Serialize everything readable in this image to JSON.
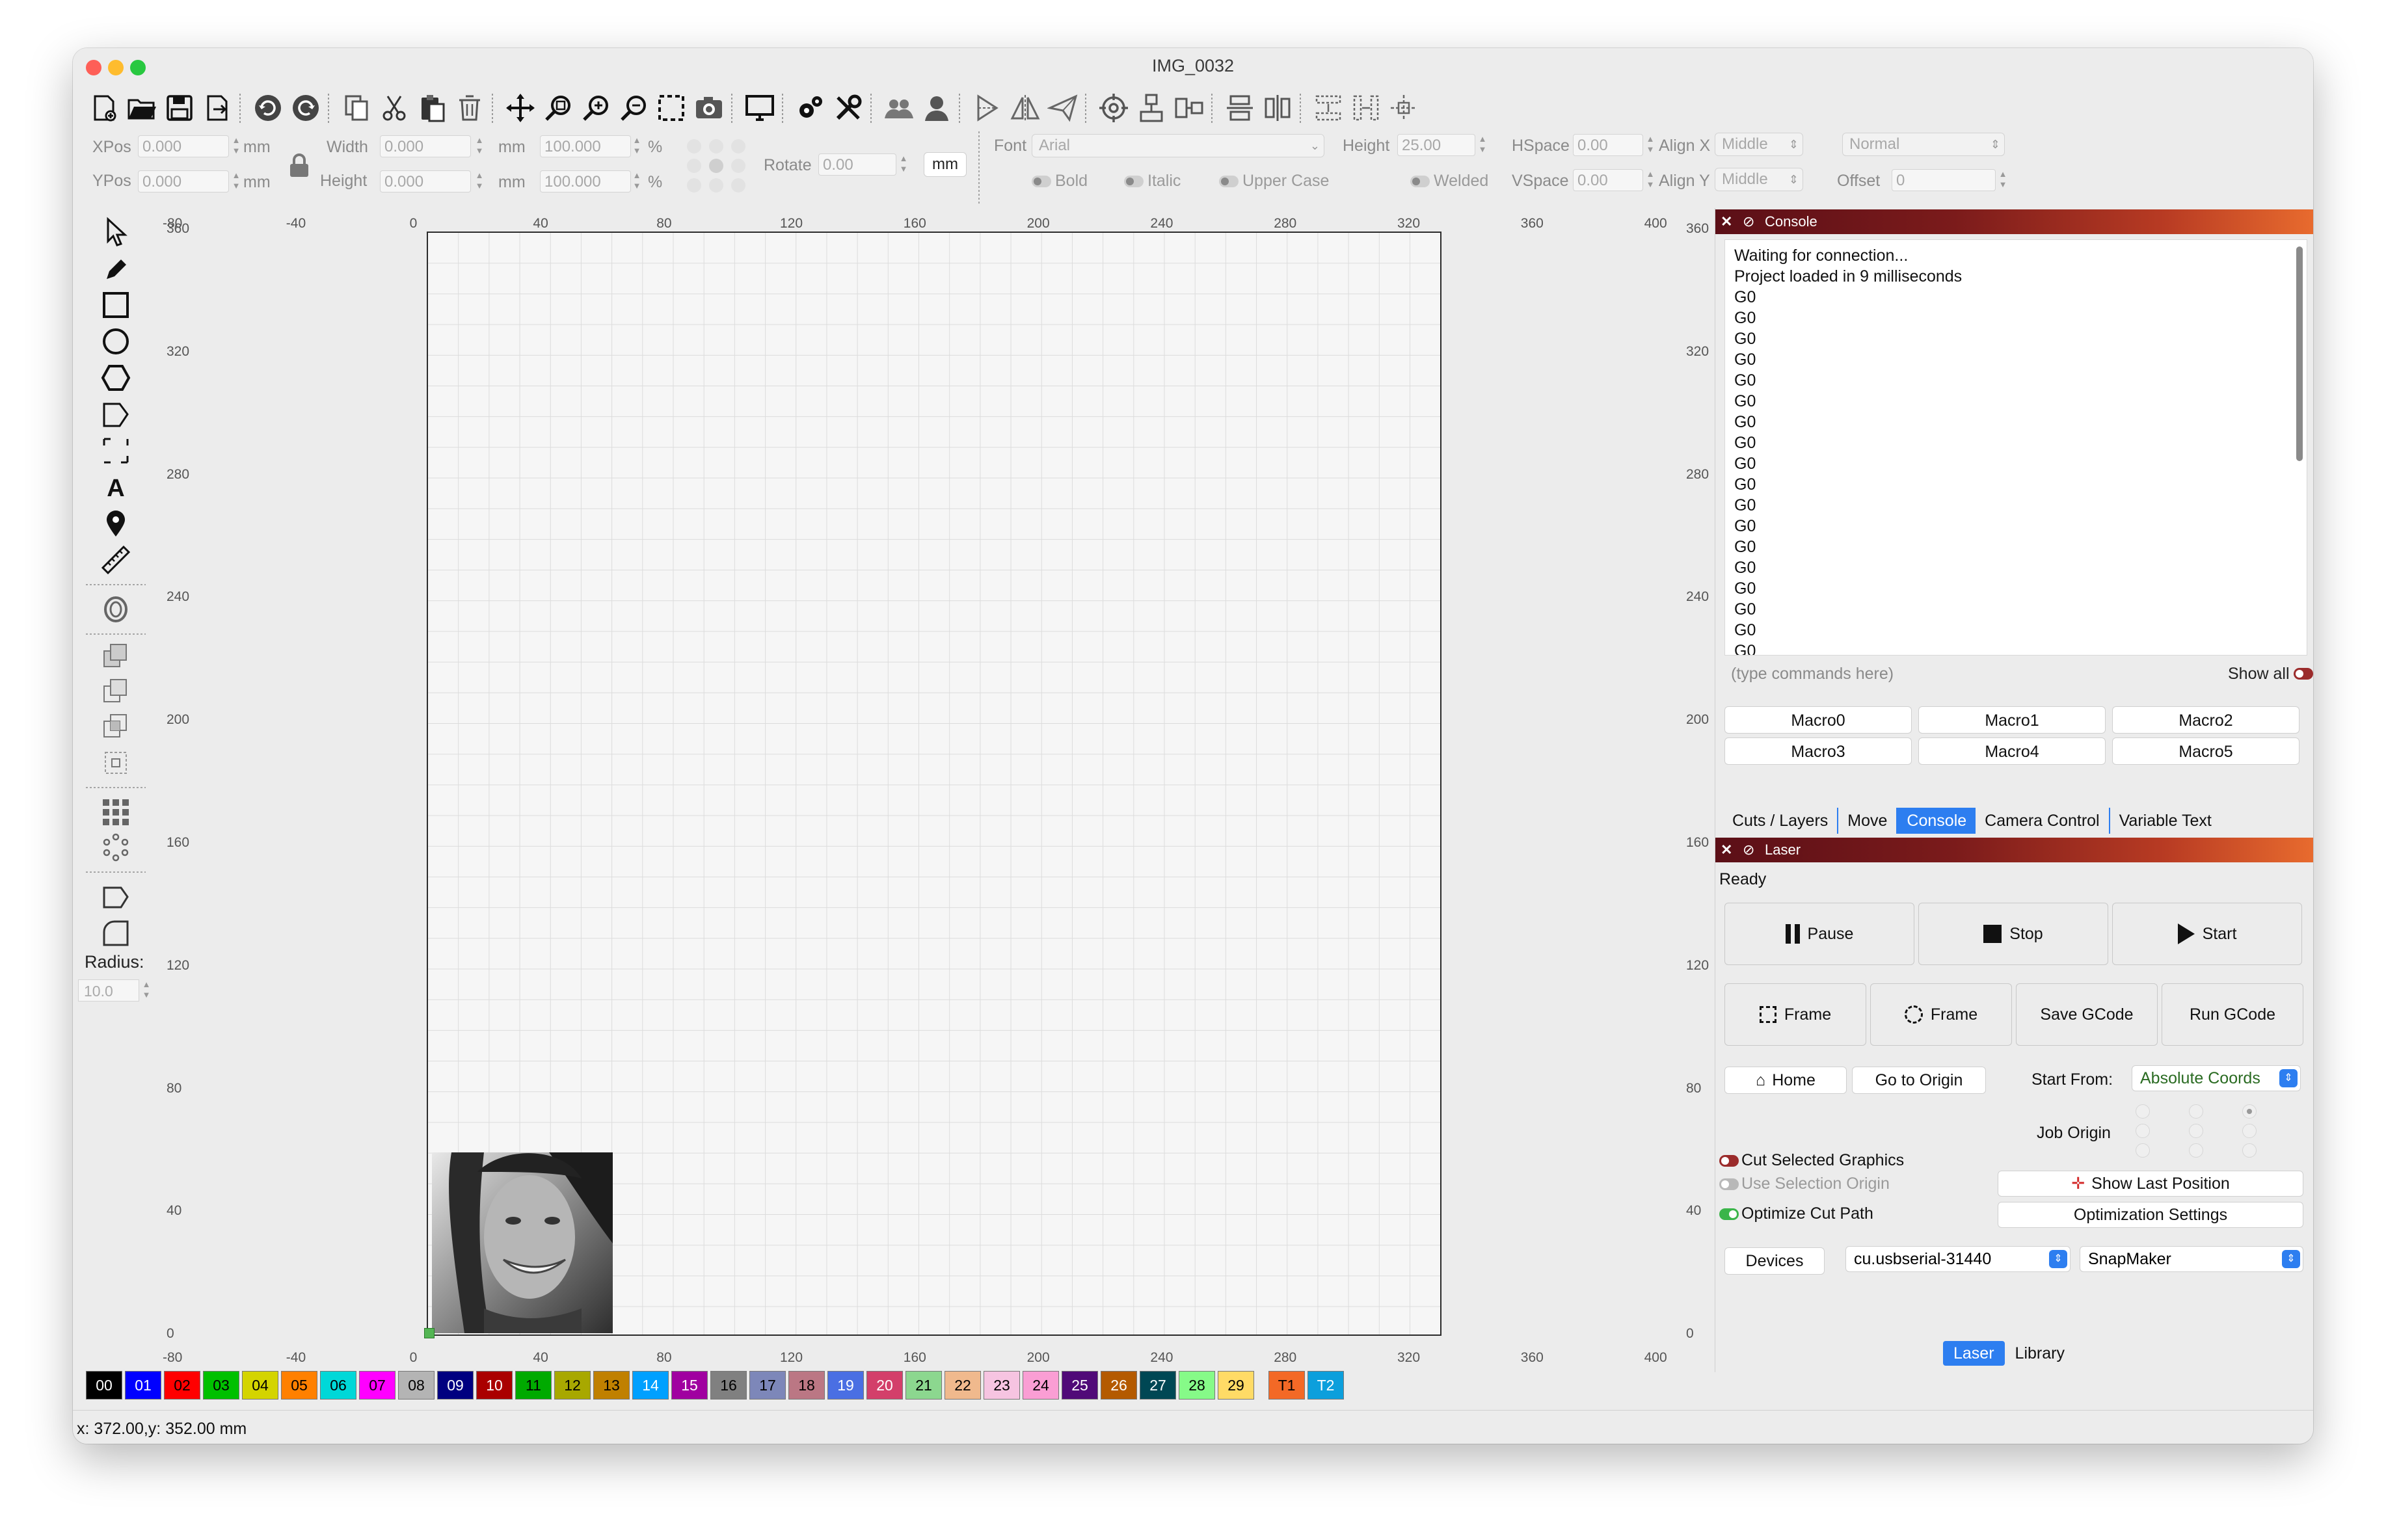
{
  "window": {
    "title": "IMG_0032"
  },
  "props": {
    "xpos_label": "XPos",
    "xpos": "0.000",
    "ypos_label": "YPos",
    "ypos": "0.000",
    "unit_mm": "mm",
    "width_label": "Width",
    "width": "0.000",
    "height_label": "Height",
    "height": "0.000",
    "scale_w": "100.000",
    "scale_h": "100.000",
    "pct": "%",
    "rotate_label": "Rotate",
    "rotate": "0.00",
    "mm_button": "mm",
    "font_label": "Font",
    "font": "Arial",
    "fheight_label": "Height",
    "fheight": "25.00",
    "hspace_label": "HSpace",
    "hspace": "0.00",
    "vspace_label": "VSpace",
    "vspace": "0.00",
    "alignx_label": "Align X",
    "alignx": "Middle",
    "aligny_label": "Align Y",
    "aligny": "Middle",
    "style": "Normal",
    "offset_label": "Offset",
    "offset": "0",
    "bold": "Bold",
    "italic": "Italic",
    "upper": "Upper Case",
    "welded": "Welded"
  },
  "left": {
    "radius_label": "Radius:",
    "radius": "10.0"
  },
  "ruler": {
    "top": [
      "-80",
      "-40",
      "0",
      "40",
      "80",
      "120",
      "160",
      "200",
      "240",
      "280",
      "320",
      "360",
      "400"
    ],
    "bottom": [
      "-80",
      "-40",
      "0",
      "40",
      "80",
      "120",
      "160",
      "200",
      "240",
      "280",
      "320",
      "360",
      "400"
    ],
    "left": [
      "360",
      "320",
      "280",
      "240",
      "200",
      "160",
      "120",
      "80",
      "40",
      "0"
    ],
    "right": [
      "360",
      "320",
      "280",
      "240",
      "200",
      "160",
      "120",
      "80",
      "40",
      "0"
    ]
  },
  "console": {
    "title": "Console",
    "lines": [
      "Waiting for connection...",
      "Project loaded in 9 milliseconds",
      "G0",
      "G0",
      "G0",
      "G0",
      "G0",
      "G0",
      "G0",
      "G0",
      "G0",
      "G0",
      "G0",
      "G0",
      "G0",
      "G0",
      "G0",
      "G0",
      "G0",
      "G0"
    ],
    "cmd_placeholder": "(type commands here)",
    "show_all": "Show all",
    "macros": [
      "Macro0",
      "Macro1",
      "Macro2",
      "Macro3",
      "Macro4",
      "Macro5"
    ],
    "tabs": [
      "Cuts / Layers",
      "Move",
      "Console",
      "Camera Control",
      "Variable Text"
    ],
    "active_tab": "Console"
  },
  "laser": {
    "title": "Laser",
    "status": "Ready",
    "pause": "Pause",
    "stop": "Stop",
    "start": "Start",
    "frame1": "Frame",
    "frame2": "Frame",
    "save_gcode": "Save GCode",
    "run_gcode": "Run GCode",
    "home": "Home",
    "go_origin": "Go to Origin",
    "start_from_label": "Start From:",
    "start_from": "Absolute Coords",
    "job_origin": "Job Origin",
    "cut_selected": "Cut Selected Graphics",
    "use_selection": "Use Selection Origin",
    "optimize": "Optimize Cut Path",
    "show_last": "Show Last Position",
    "opt_settings": "Optimization Settings",
    "devices": "Devices",
    "port": "cu.usbserial-31440",
    "device": "SnapMaker",
    "bottom_tabs": [
      "Laser",
      "Library"
    ]
  },
  "palette": [
    {
      "label": "00",
      "color": "#000000",
      "text": "#ffffff"
    },
    {
      "label": "01",
      "color": "#0000ff",
      "text": "#ffffff"
    },
    {
      "label": "02",
      "color": "#ff0000",
      "text": "#000000"
    },
    {
      "label": "03",
      "color": "#00c000",
      "text": "#000000"
    },
    {
      "label": "04",
      "color": "#d4d400",
      "text": "#000000"
    },
    {
      "label": "05",
      "color": "#ff8000",
      "text": "#000000"
    },
    {
      "label": "06",
      "color": "#00d8d8",
      "text": "#000000"
    },
    {
      "label": "07",
      "color": "#ff00ff",
      "text": "#000000"
    },
    {
      "label": "08",
      "color": "#b4b4b4",
      "text": "#000000"
    },
    {
      "label": "09",
      "color": "#000080",
      "text": "#ffffff"
    },
    {
      "label": "10",
      "color": "#aa0000",
      "text": "#ffffff"
    },
    {
      "label": "11",
      "color": "#00aa00",
      "text": "#000000"
    },
    {
      "label": "12",
      "color": "#a8a800",
      "text": "#000000"
    },
    {
      "label": "13",
      "color": "#c08000",
      "text": "#000000"
    },
    {
      "label": "14",
      "color": "#00a0ff",
      "text": "#ffffff"
    },
    {
      "label": "15",
      "color": "#a000a0",
      "text": "#ffffff"
    },
    {
      "label": "16",
      "color": "#808080",
      "text": "#000000"
    },
    {
      "label": "17",
      "color": "#7d87b9",
      "text": "#000000"
    },
    {
      "label": "18",
      "color": "#bb7784",
      "text": "#000000"
    },
    {
      "label": "19",
      "color": "#4a6fe3",
      "text": "#ffffff"
    },
    {
      "label": "20",
      "color": "#d33f6a",
      "text": "#ffffff"
    },
    {
      "label": "21",
      "color": "#8cd78f",
      "text": "#000000"
    },
    {
      "label": "22",
      "color": "#f0b98d",
      "text": "#000000"
    },
    {
      "label": "23",
      "color": "#f6c4e1",
      "text": "#000000"
    },
    {
      "label": "24",
      "color": "#fa9ed4",
      "text": "#000000"
    },
    {
      "label": "25",
      "color": "#500a78",
      "text": "#ffffff"
    },
    {
      "label": "26",
      "color": "#b45a00",
      "text": "#ffffff"
    },
    {
      "label": "27",
      "color": "#004754",
      "text": "#ffffff"
    },
    {
      "label": "28",
      "color": "#86fa88",
      "text": "#000000"
    },
    {
      "label": "29",
      "color": "#ffdb66",
      "text": "#000000"
    },
    {
      "label": "T1",
      "color": "#f36926",
      "text": "#000000"
    },
    {
      "label": "T2",
      "color": "#0c9fdc",
      "text": "#ffffff"
    }
  ],
  "statusbar": {
    "coords": "x: 372.00,y: 352.00 mm"
  },
  "colors": {
    "accent": "#2d7ef0",
    "dock_title_start": "#5b0f17",
    "dock_title_end": "#e86b2e"
  }
}
